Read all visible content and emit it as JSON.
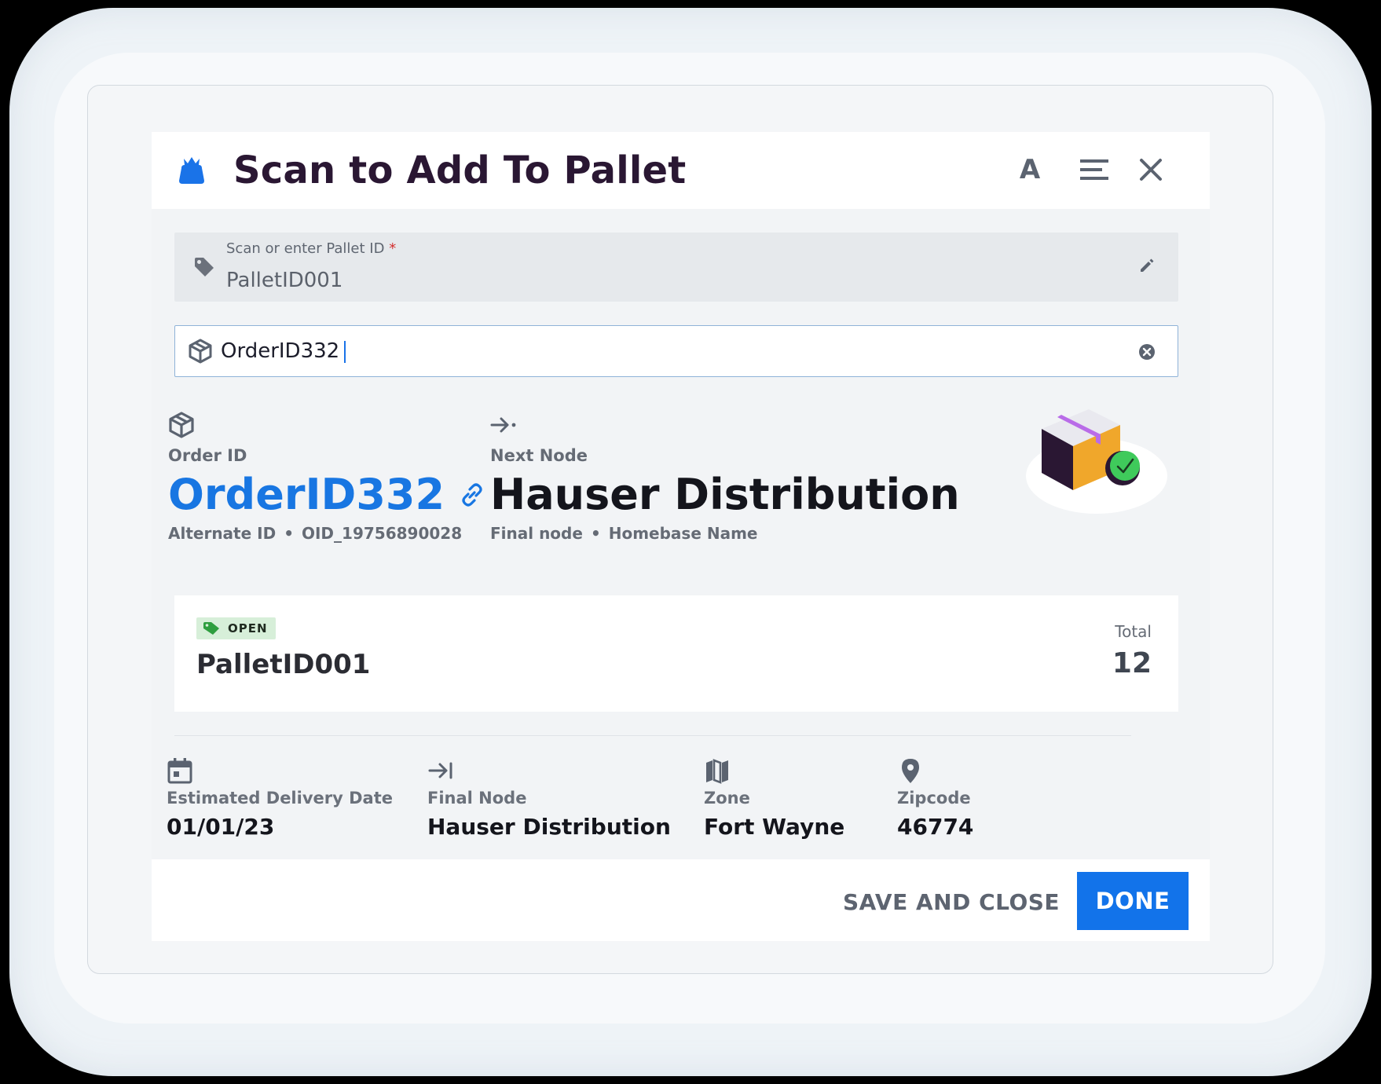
{
  "dialog": {
    "title": "Scan to Add To Pallet",
    "font_button_label": "A"
  },
  "pallet_field": {
    "label": "Scan or enter Pallet ID",
    "required_mark": "*",
    "value": "PalletID001"
  },
  "order_field": {
    "value": "OrderID332"
  },
  "order_info": {
    "order_label": "Order ID",
    "order_id": "OrderID332",
    "alternate_label": "Alternate ID",
    "alternate_value": "OID_19756890028",
    "next_node_label": "Next Node",
    "next_node_value": "Hauser Distribution",
    "final_node_text": "Final node",
    "homebase_text": "Homebase Name",
    "separator": "•"
  },
  "pallet_card": {
    "status": "OPEN",
    "pallet_id": "PalletID001",
    "total_label": "Total",
    "total_value": "12"
  },
  "details": [
    {
      "label": "Estimated Delivery Date",
      "value": "01/01/23",
      "icon": "calendar-icon"
    },
    {
      "label": "Final Node",
      "value": "Hauser Distribution",
      "icon": "arrow-to-end-icon"
    },
    {
      "label": "Zone",
      "value": "Fort Wayne",
      "icon": "map-icon"
    },
    {
      "label": "Zipcode",
      "value": "46774",
      "icon": "location-pin-icon"
    }
  ],
  "footer": {
    "save_label": "SAVE AND CLOSE",
    "done_label": "DONE"
  },
  "colors": {
    "accent": "#1273ea",
    "title": "#2a1733",
    "status_badge_bg": "#d7efd9",
    "status_icon": "#2e9e3f"
  }
}
